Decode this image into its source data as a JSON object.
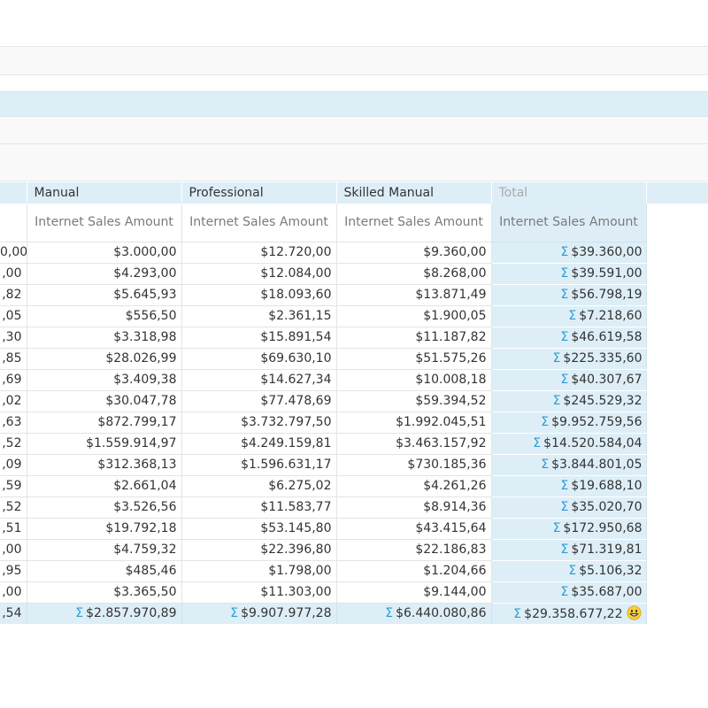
{
  "header": {
    "groups": [
      "Manual",
      "Professional",
      "Skilled Manual",
      "Total"
    ],
    "measure": "Internet Sales Amount"
  },
  "sigma_symbol": "Σ",
  "rows": [
    [
      "0,00",
      "$3.000,00",
      "$12.720,00",
      "$9.360,00",
      "$39.360,00"
    ],
    [
      ",00",
      "$4.293,00",
      "$12.084,00",
      "$8.268,00",
      "$39.591,00"
    ],
    [
      ",82",
      "$5.645,93",
      "$18.093,60",
      "$13.871,49",
      "$56.798,19"
    ],
    [
      ",05",
      "$556,50",
      "$2.361,15",
      "$1.900,05",
      "$7.218,60"
    ],
    [
      ",30",
      "$3.318,98",
      "$15.891,54",
      "$11.187,82",
      "$46.619,58"
    ],
    [
      ",85",
      "$28.026,99",
      "$69.630,10",
      "$51.575,26",
      "$225.335,60"
    ],
    [
      ",69",
      "$3.409,38",
      "$14.627,34",
      "$10.008,18",
      "$40.307,67"
    ],
    [
      ",02",
      "$30.047,78",
      "$77.478,69",
      "$59.394,52",
      "$245.529,32"
    ],
    [
      ",63",
      "$872.799,17",
      "$3.732.797,50",
      "$1.992.045,51",
      "$9.952.759,56"
    ],
    [
      ",52",
      "$1.559.914,97",
      "$4.249.159,81",
      "$3.463.157,92",
      "$14.520.584,04"
    ],
    [
      ",09",
      "$312.368,13",
      "$1.596.631,17",
      "$730.185,36",
      "$3.844.801,05"
    ],
    [
      ",59",
      "$2.661,04",
      "$6.275,02",
      "$4.261,26",
      "$19.688,10"
    ],
    [
      ",52",
      "$3.526,56",
      "$11.583,77",
      "$8.914,36",
      "$35.020,70"
    ],
    [
      ",51",
      "$19.792,18",
      "$53.145,80",
      "$43.415,64",
      "$172.950,68"
    ],
    [
      ",00",
      "$4.759,32",
      "$22.396,80",
      "$22.186,83",
      "$71.319,81"
    ],
    [
      ",95",
      "$485,46",
      "$1.798,00",
      "$1.204,66",
      "$5.106,32"
    ],
    [
      ",00",
      "$3.365,50",
      "$11.303,00",
      "$9.144,00",
      "$35.687,00"
    ]
  ],
  "totals": [
    ",54",
    "$2.857.970,89",
    "$9.907.977,28",
    "$6.440.080,86",
    "$29.358.677,22"
  ],
  "colors": {
    "header_bg": "#ddeef7",
    "sigma": "#2a9bd6",
    "muted_header": "#aaaaaa"
  },
  "icons": {
    "grand_total": "smiley-icon"
  }
}
